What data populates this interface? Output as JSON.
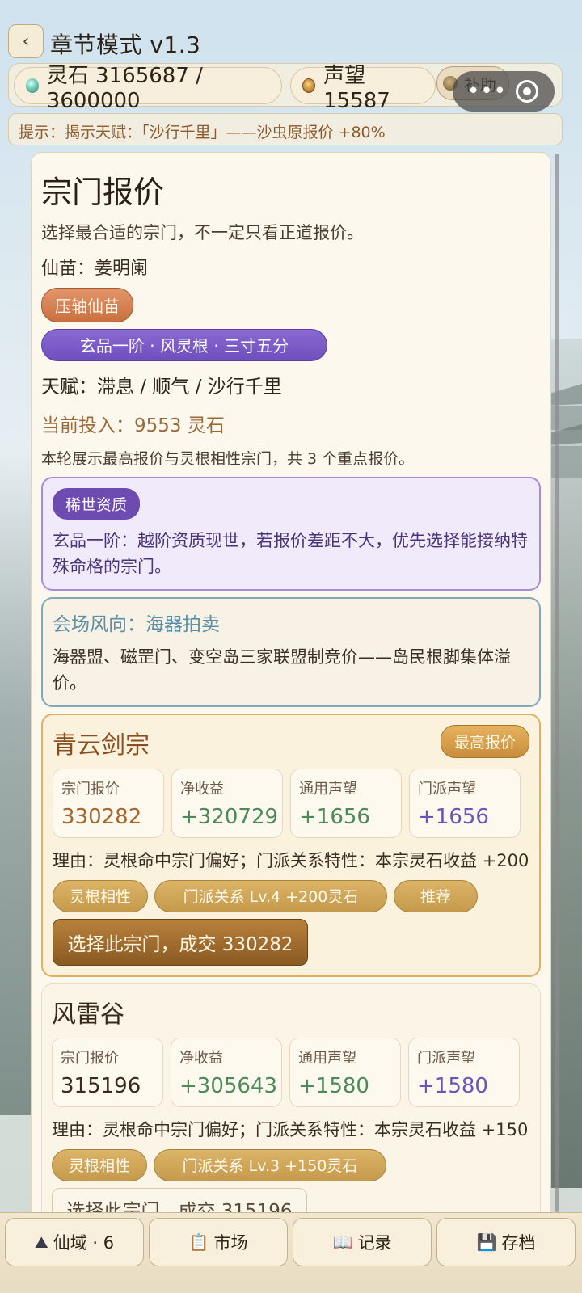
{
  "header": {
    "back_icon": "chevron-left-icon",
    "back_glyph": "‹",
    "title": "章节模式 v1.3"
  },
  "resources": {
    "spirit_stone": "灵石 3165687 / 3600000",
    "fame": "声望 15587",
    "aid_button": "补助"
  },
  "capsule": {
    "more": "•••"
  },
  "hint": "提示：揭示天赋：「沙行千里」——沙虫原报价 +80%",
  "main": {
    "title": "宗门报价",
    "subtitle": "选择最合适的宗门，不一定只看正道报价。",
    "seedling": "仙苗：姜明阑",
    "finale_badge": "压轴仙苗",
    "grade_pill": "玄品一阶 · 风灵根 · 三寸五分",
    "talents": "天赋：滞息 / 顺气 / 沙行千里",
    "investment": "当前投入：9553 灵石",
    "summary": "本轮展示最高报价与灵根相性宗门，共 3 个重点报价。"
  },
  "rare_box": {
    "tag": "稀世资质",
    "text": "玄品一阶：越阶资质现世，若报价差距不大，优先选择能接纳特殊命格的宗门。"
  },
  "wind_box": {
    "title": "会场风向：海器拍卖",
    "text": "海器盟、磁罡门、变空岛三家联盟制竞价——岛民根脚集体溢价。"
  },
  "sects": [
    {
      "name": "青云剑宗",
      "badge": "最高报价",
      "stats": [
        {
          "label": "宗门报价",
          "value": "330282"
        },
        {
          "label": "净收益",
          "value": "+320729"
        },
        {
          "label": "通用声望",
          "value": "+1656"
        },
        {
          "label": "门派声望",
          "value": "+1656"
        }
      ],
      "reason": "理由：灵根命中宗门偏好；门派关系特性：本宗灵石收益 +200",
      "tags": [
        "灵根相性",
        "门派关系 Lv.4 +200灵石",
        "推荐"
      ],
      "action": "选择此宗门，成交 330282"
    },
    {
      "name": "风雷谷",
      "stats": [
        {
          "label": "宗门报价",
          "value": "315196"
        },
        {
          "label": "净收益",
          "value": "+305643"
        },
        {
          "label": "通用声望",
          "value": "+1580"
        },
        {
          "label": "门派声望",
          "value": "+1580"
        }
      ],
      "reason": "理由：灵根命中宗门偏好；门派关系特性：本宗灵石收益 +150",
      "tags": [
        "灵根相性",
        "门派关系 Lv.3 +150灵石"
      ],
      "action": "选择此宗门，成交 315196"
    }
  ],
  "bottom_nav": [
    {
      "icon": "mountain-icon",
      "glyph": "⛰",
      "label": "仙域 · 6"
    },
    {
      "icon": "clipboard-icon",
      "glyph": "📋",
      "label": "市场"
    },
    {
      "icon": "book-icon",
      "glyph": "📖",
      "label": "记录"
    },
    {
      "icon": "floppy-disk-icon",
      "glyph": "💾",
      "label": "存档"
    }
  ]
}
